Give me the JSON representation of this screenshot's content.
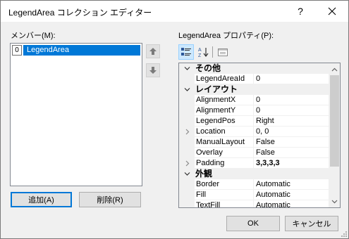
{
  "window": {
    "title": "LegendArea コレクション エディター",
    "help_label": "?"
  },
  "members": {
    "label": "メンバー(M):",
    "items": [
      {
        "index": "0",
        "name": "LegendArea"
      }
    ]
  },
  "buttons": {
    "add": "追加(A)",
    "remove": "削除(R)",
    "ok": "OK",
    "cancel": "キャンセル"
  },
  "properties": {
    "label": "LegendArea プロパティ(P):",
    "categories": [
      {
        "name": "その他",
        "expanded": true,
        "props": [
          {
            "name": "LegendAreaId",
            "value": "0"
          }
        ]
      },
      {
        "name": "レイアウト",
        "expanded": true,
        "props": [
          {
            "name": "AlignmentX",
            "value": "0"
          },
          {
            "name": "AlignmentY",
            "value": "0"
          },
          {
            "name": "LegendPos",
            "value": "Right"
          },
          {
            "name": "Location",
            "value": "0, 0",
            "expandable": true
          },
          {
            "name": "ManualLayout",
            "value": "False"
          },
          {
            "name": "Overlay",
            "value": "False"
          },
          {
            "name": "Padding",
            "value": "3,3,3,3",
            "expandable": true,
            "bold": true
          }
        ]
      },
      {
        "name": "外観",
        "expanded": true,
        "props": [
          {
            "name": "Border",
            "value": "Automatic"
          },
          {
            "name": "Fill",
            "value": "Automatic"
          },
          {
            "name": "TextFill",
            "value": "Automatic"
          }
        ]
      }
    ]
  },
  "icons": {
    "close": "close-icon",
    "up": "arrow-up-icon",
    "down": "arrow-down-icon",
    "categorized": "categorized-icon",
    "alphabetical": "alphabetical-sort-icon",
    "property_pages": "property-pages-icon"
  },
  "colors": {
    "selection": "#0078d7",
    "focus_border": "#0078d7",
    "dialog_bg": "#f0f0f0"
  }
}
